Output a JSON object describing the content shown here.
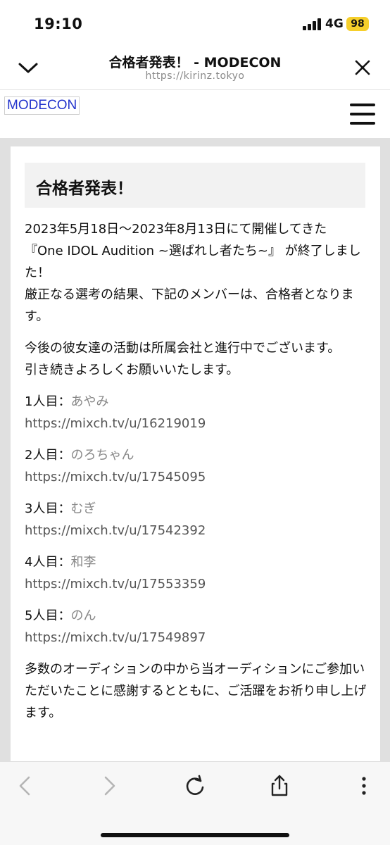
{
  "status_bar": {
    "time": "19:10",
    "network": "4G",
    "battery": "98"
  },
  "browser": {
    "title": "合格者発表！ - MODECON",
    "url": "https://kirinz.tokyo",
    "icons": {
      "collapse": "chevron-down-icon",
      "close": "close-icon",
      "back": "arrow-left-icon",
      "forward": "arrow-right-icon",
      "reload": "reload-icon",
      "share": "share-icon",
      "more": "more-vertical-icon"
    }
  },
  "site": {
    "logo": "MODECON",
    "menu_icon": "hamburger-menu-icon"
  },
  "article": {
    "heading": "合格者発表！",
    "intro_1": "2023年5月18日〜2023年8月13日にて開催してきた 『One IDOL Audition ~選ばれし者たち~』 が終了しました！",
    "intro_2": "厳正なる選考の結果、下記のメンバーは、合格者となります。",
    "activity_1": "今後の彼女達の活動は所属会社と進行中でございます。",
    "activity_2": "引き続きよろしくお願いいたします。",
    "members": [
      {
        "label": "1人目：",
        "name": "あやみ",
        "url": "https://mixch.tv/u/16219019"
      },
      {
        "label": "2人目：",
        "name": "のろちゃん",
        "url": "https://mixch.tv/u/17545095"
      },
      {
        "label": "3人目：",
        "name": "むぎ",
        "url": "https://mixch.tv/u/17542392"
      },
      {
        "label": "4人目：",
        "name": "和李",
        "url": "https://mixch.tv/u/17553359"
      },
      {
        "label": "5人目：",
        "name": "のん",
        "url": "https://mixch.tv/u/17549897"
      }
    ],
    "closing": "多数のオーディションの中から当オーディションにご参加いただいたことに感謝するとともに、ご活躍をお祈り申し上げます。"
  }
}
